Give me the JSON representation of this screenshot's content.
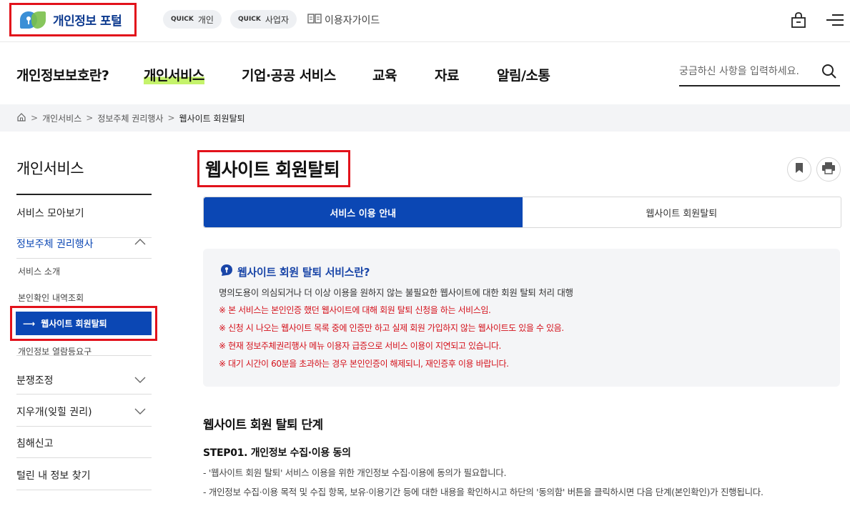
{
  "header": {
    "logo_text": "개인정보 포털",
    "quick_prefix": "QUICK",
    "quick_personal": "개인",
    "quick_business": "사업자",
    "user_guide": "이용자가이드"
  },
  "gnb": {
    "items": [
      "개인정보보호란?",
      "개인서비스",
      "기업·공공 서비스",
      "교육",
      "자료",
      "알림/소통"
    ],
    "search_placeholder": "궁금하신 사항을 입력하세요."
  },
  "breadcrumb": {
    "items": [
      "개인서비스",
      "정보주체 권리행사",
      "웹사이트 회원탈퇴"
    ],
    "separator": ">"
  },
  "sidebar": {
    "title": "개인서비스",
    "items": [
      "서비스 모아보기",
      "정보주체 권리행사",
      "분쟁조정",
      "지우개(잊힐 권리)",
      "침해신고",
      "털린 내 정보 찾기"
    ],
    "sub_items": [
      "서비스 소개",
      "본인확인 내역조회",
      "웹사이트 회원탈퇴",
      "개인정보 열람등요구"
    ],
    "active_arrow": "⟶"
  },
  "page": {
    "title": "웹사이트 회원탈퇴",
    "tabs": [
      "서비스 이용 안내",
      "웹사이트 회원탈퇴"
    ]
  },
  "info": {
    "heading": "웹사이트 회원 탈퇴 서비스란?",
    "description": "명의도용이 의심되거나 더 이상 이용을 원하지 않는 불필요한 웹사이트에 대한 회원 탈퇴 처리 대행",
    "notes": [
      "※ 본 서비스는 본인인증 했던 웹사이트에 대해 회원 탈퇴 신청을 하는 서비스임.",
      "※ 신청 시 나오는 웹사이트 목록 중에 인증만 하고 실제 회원 가입하지 않는 웹사이트도 있을 수 있음.",
      "※ 현재 정보주체권리행사 메뉴 이용자 급증으로 서비스 이용이 지연되고 있습니다.",
      "※ 대기 시간이 60분을 초과하는 경우 본인인증이 해제되니, 재인증후 이용 바랍니다."
    ]
  },
  "steps": {
    "heading": "웹사이트 회원 탈퇴 단계",
    "step1_title": "STEP01. 개인정보 수집·이용 동의",
    "step1_lines": [
      "- '웹사이트 회원 탈퇴' 서비스 이용을 위한 개인정보 수집·이용에 동의가 필요합니다.",
      "- 개인정보 수집·이용 목적 및 수집 항목, 보유·이용기간 등에 대한 내용을 확인하시고 하단의 '동의함' 버튼을 클릭하시면 다음 단계(본인확인)가 진행됩니다."
    ]
  },
  "colors": {
    "primary": "#0b47b4",
    "highlight_red": "#e2121b",
    "note_red": "#d4101a",
    "gnb_underline": "#c5f36b"
  }
}
